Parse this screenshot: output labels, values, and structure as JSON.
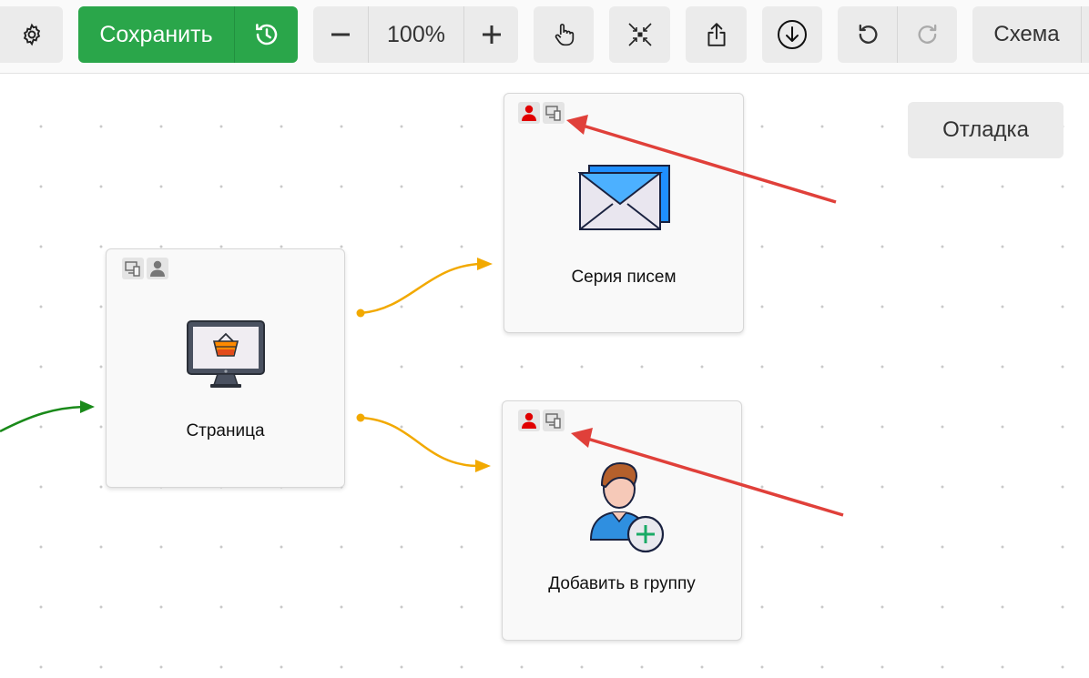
{
  "toolbar": {
    "settings_icon": "gear-icon",
    "save_label": "Сохранить",
    "history_icon": "history-icon",
    "zoom_out_icon": "minus-icon",
    "zoom_value": "100%",
    "zoom_in_icon": "plus-icon",
    "pan_icon": "hand-pointer-icon",
    "fit_icon": "collapse-icon",
    "export_icon": "share-icon",
    "download_icon": "download-icon",
    "undo_icon": "undo-icon",
    "redo_icon": "redo-icon",
    "schema_label": "Схема"
  },
  "canvas": {
    "debug_label": "Отладка",
    "nodes": [
      {
        "id": "page",
        "label": "Страница",
        "icon": "monitor-basket-icon"
      },
      {
        "id": "email-series",
        "label": "Серия писем",
        "icon": "envelope-icon"
      },
      {
        "id": "add-to-group",
        "label": "Добавить в группу",
        "icon": "add-user-icon"
      }
    ]
  },
  "colors": {
    "save": "#2aa64a",
    "connector_orange": "#f2a900",
    "connector_green": "#1a8a1a",
    "annotation_arrow": "#e0403a",
    "badge_red": "#e00000"
  }
}
